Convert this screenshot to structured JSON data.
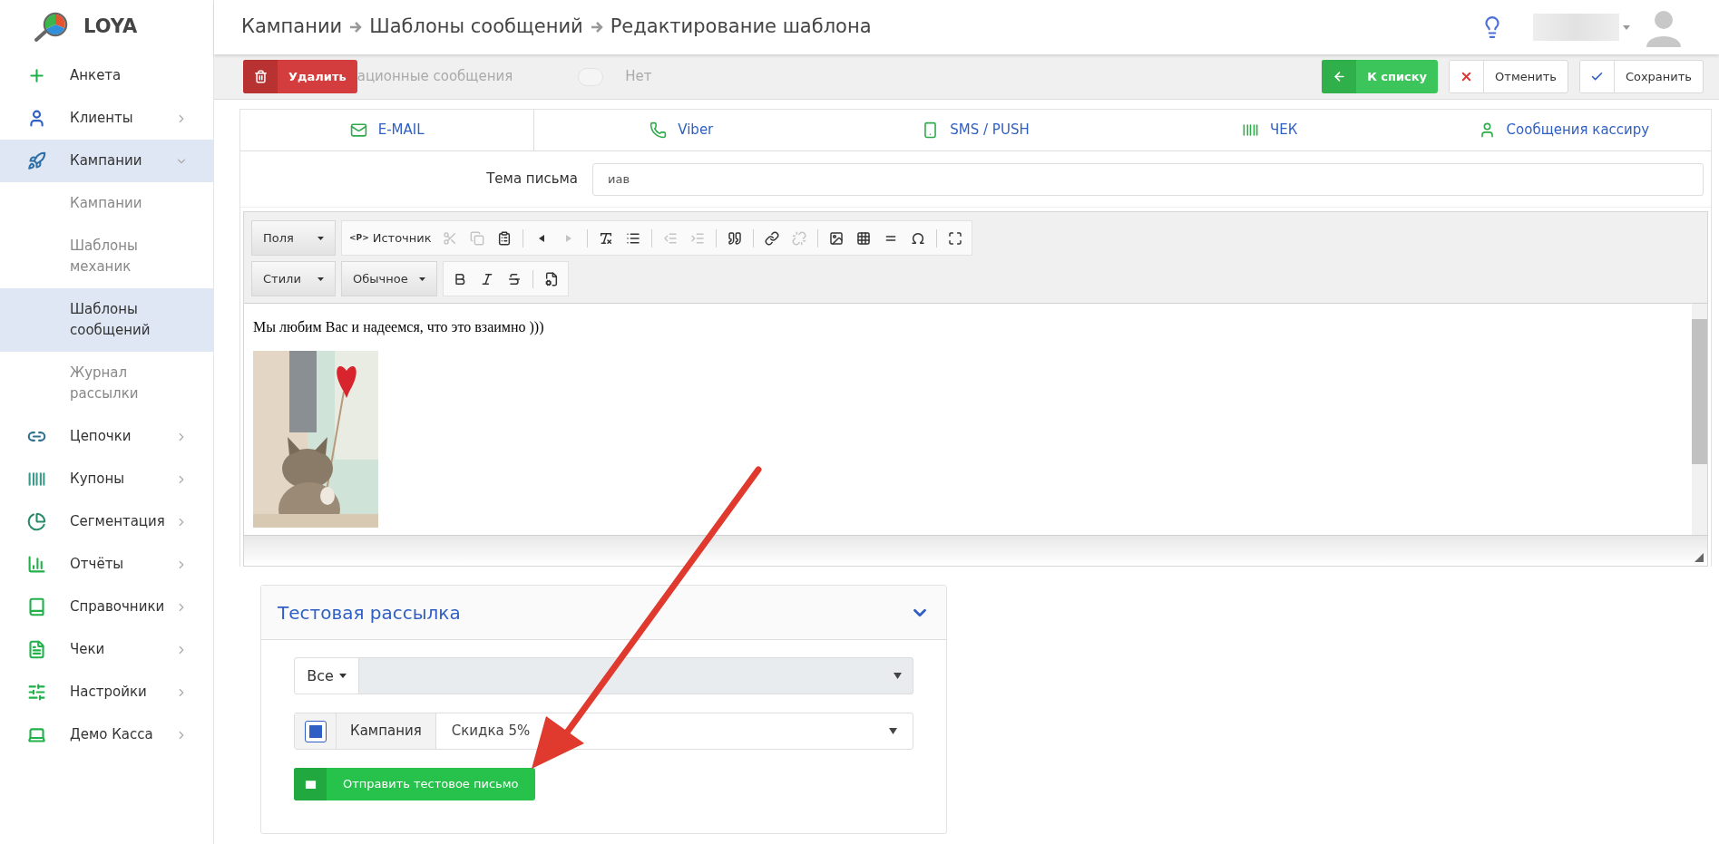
{
  "brand": {
    "name": "LOYA"
  },
  "breadcrumbs": [
    "Кампании",
    "Шаблоны сообщений",
    "Редактирование шаблона"
  ],
  "sidebar": {
    "items": [
      {
        "label": "Анкета",
        "has_submenu": false,
        "expanded": false,
        "selected": false
      },
      {
        "label": "Клиенты",
        "has_submenu": true,
        "expanded": false,
        "selected": false
      },
      {
        "label": "Кампании",
        "has_submenu": true,
        "expanded": true,
        "selected": true,
        "children": [
          {
            "label": "Кампании",
            "selected": false
          },
          {
            "label": "Шаблоны механик",
            "selected": false
          },
          {
            "label": "Шаблоны сообщений",
            "selected": true
          },
          {
            "label": "Журнал рассылки",
            "selected": false
          }
        ]
      },
      {
        "label": "Цепочки",
        "has_submenu": true,
        "expanded": false,
        "selected": false
      },
      {
        "label": "Купоны",
        "has_submenu": true,
        "expanded": false,
        "selected": false
      },
      {
        "label": "Сегментация",
        "has_submenu": true,
        "expanded": false,
        "selected": false
      },
      {
        "label": "Отчёты",
        "has_submenu": true,
        "expanded": false,
        "selected": false
      },
      {
        "label": "Справочники",
        "has_submenu": true,
        "expanded": false,
        "selected": false
      },
      {
        "label": "Чеки",
        "has_submenu": true,
        "expanded": false,
        "selected": false
      },
      {
        "label": "Настройки",
        "has_submenu": true,
        "expanded": false,
        "selected": false
      },
      {
        "label": "Демо Касса",
        "has_submenu": true,
        "expanded": false,
        "selected": false
      }
    ]
  },
  "action_bar": {
    "field_label_visible": "ационные сообщения",
    "toggle": {
      "on": false,
      "label": "Нет"
    },
    "buttons": [
      {
        "kind": "delete",
        "label": "Удалить"
      },
      {
        "kind": "back",
        "label": "К списку"
      },
      {
        "kind": "cancel",
        "label": "Отменить"
      },
      {
        "kind": "save",
        "label": "Сохранить"
      }
    ]
  },
  "tabs": [
    {
      "label": "E-MAIL",
      "selected": true
    },
    {
      "label": "Viber",
      "selected": false
    },
    {
      "label": "SMS / PUSH",
      "selected": false
    },
    {
      "label": "ЧЕК",
      "selected": false
    },
    {
      "label": "Сообщения кассиру",
      "selected": false
    }
  ],
  "subject": {
    "label": "Тема письма",
    "value": "иав"
  },
  "editor": {
    "toolbar_rows": [
      [
        {
          "kind": "dropdown",
          "label": "Поля"
        },
        {
          "kind": "source",
          "icon_text": "<P>",
          "label": "Источник"
        },
        {
          "kind": "icon",
          "disabled": true
        },
        {
          "kind": "icon",
          "disabled": true
        },
        {
          "kind": "icon",
          "disabled": false
        },
        {
          "kind": "separator"
        },
        {
          "kind": "icon",
          "disabled": false
        },
        {
          "kind": "icon",
          "disabled": true
        },
        {
          "kind": "separator"
        },
        {
          "kind": "icon",
          "disabled": false
        },
        {
          "kind": "icon",
          "disabled": false
        },
        {
          "kind": "separator"
        },
        {
          "kind": "icon",
          "disabled": true
        },
        {
          "kind": "icon",
          "disabled": true
        },
        {
          "kind": "separator"
        },
        {
          "kind": "icon",
          "disabled": false
        },
        {
          "kind": "separator"
        },
        {
          "kind": "icon",
          "disabled": false
        },
        {
          "kind": "icon",
          "disabled": true
        },
        {
          "kind": "separator"
        },
        {
          "kind": "icon",
          "disabled": false
        },
        {
          "kind": "icon",
          "disabled": false
        },
        {
          "kind": "icon",
          "disabled": false
        },
        {
          "kind": "icon",
          "disabled": false
        },
        {
          "kind": "separator"
        },
        {
          "kind": "icon",
          "disabled": false
        }
      ],
      [
        {
          "kind": "dropdown",
          "label": "Стили"
        },
        {
          "kind": "dropdown",
          "label": "Обычное"
        },
        {
          "kind": "icon",
          "disabled": false
        },
        {
          "kind": "icon",
          "disabled": false
        },
        {
          "kind": "icon",
          "disabled": false
        },
        {
          "kind": "separator"
        },
        {
          "kind": "icon",
          "disabled": false
        }
      ]
    ],
    "text": "Мы любим Вас и надеемся, что это взаимно )))"
  },
  "test_panel": {
    "title": "Тестовая рассылка",
    "expanded": true,
    "recipient_filter": "Все",
    "campaign": {
      "checked": true,
      "label": "Кампания",
      "value": "Скидка 5%"
    },
    "send_button": "Отправить тестовое письмо"
  }
}
